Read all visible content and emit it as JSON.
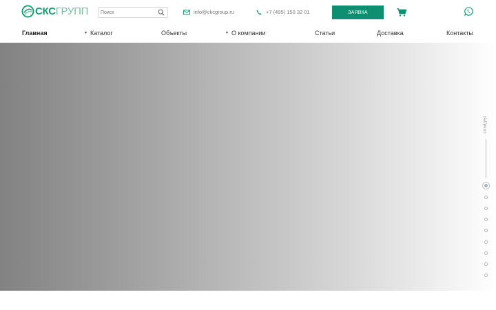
{
  "header": {
    "logo": {
      "bold": "СКС",
      "thin": "ГРУПП"
    },
    "search": {
      "placeholder": "Поиск",
      "value": ""
    },
    "email": "info@ckcgroup.ru",
    "phone": "+7 (495) 150 32 01",
    "order_button": "Заявка",
    "icons": [
      "search-icon",
      "envelope-icon",
      "phone-icon",
      "cart-icon",
      "whatsapp-icon"
    ]
  },
  "nav": {
    "items": [
      {
        "label": "Главная",
        "active": true,
        "dropdown": false
      },
      {
        "label": "Каталог",
        "active": false,
        "dropdown": true
      },
      {
        "label": "Объекты",
        "active": false,
        "dropdown": false
      },
      {
        "label": "О компании",
        "active": false,
        "dropdown": true
      },
      {
        "label": "Статьи",
        "active": false,
        "dropdown": false
      },
      {
        "label": "Доставка",
        "active": false,
        "dropdown": false
      },
      {
        "label": "Контакты",
        "active": false,
        "dropdown": false
      }
    ]
  },
  "slider": {
    "label": "слайдер",
    "slide_count": 9,
    "active_index": 0
  },
  "colors": {
    "brand_green": "#0f8f71",
    "logo_green": "#1a9a73",
    "logo_light": "#6ec29f"
  }
}
